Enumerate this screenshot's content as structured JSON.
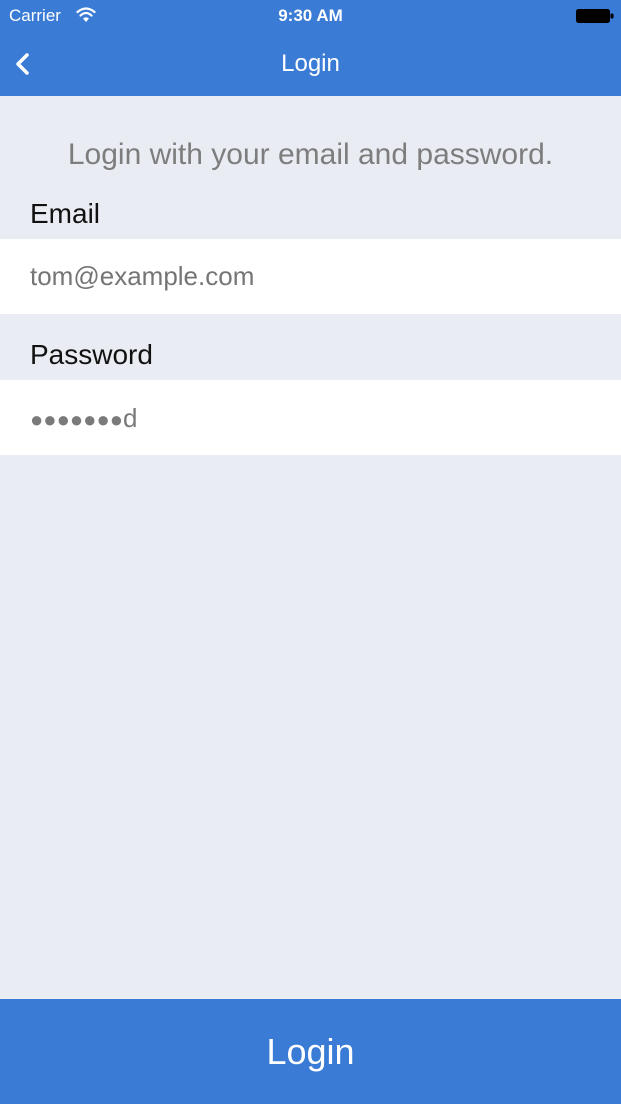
{
  "status_bar": {
    "carrier": "Carrier",
    "time": "9:30 AM"
  },
  "nav": {
    "title": "Login",
    "back_icon": "chevron-left-icon"
  },
  "intro_text": "Login with your email and password.",
  "email": {
    "label": "Email",
    "placeholder": "tom@example.com",
    "value": ""
  },
  "password": {
    "label": "Password",
    "masked_dots": "●●●●●●●",
    "last_char": "d"
  },
  "login_button": {
    "label": "Login"
  },
  "colors": {
    "accent": "#3a7bd5",
    "background": "#e9ecf3",
    "field_background": "#ffffff",
    "placeholder_text": "#7a7a7a"
  }
}
